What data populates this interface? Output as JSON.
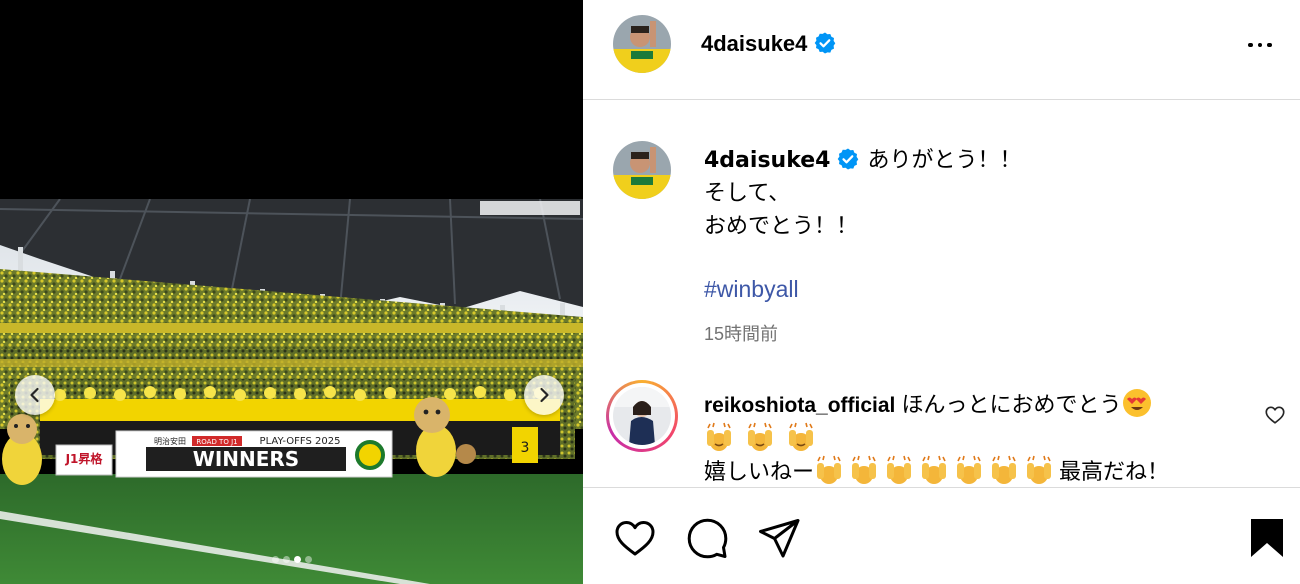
{
  "post": {
    "author": "4daisuke4",
    "verified": true,
    "caption_lines": [
      "ありがとう！！",
      "そして、",
      "おめでとう！！"
    ],
    "hashtag": "#winbyall",
    "time_ago": "15時間前"
  },
  "media": {
    "slide_count": 4,
    "active_slide": 3,
    "banner": {
      "title": "WINNERS",
      "subtitle": "PLAY-OFFS 2025",
      "sponsor": "明治安田",
      "tag": "ROAD TO J1",
      "side_sign": "J1昇格"
    }
  },
  "comment": {
    "author": "reikoshiota_official",
    "line1": "ほんっとにおめでとう",
    "line3_start": "嬉しいねー",
    "line3_end": "最高だね！"
  },
  "icons": {
    "verified": "verified-badge-icon",
    "more": "more-options-icon",
    "like": "heart-icon",
    "comment": "comment-icon",
    "share": "share-icon",
    "save": "bookmark-icon"
  },
  "colors": {
    "verified": "#0095f6",
    "hashtag": "#3d57a7",
    "muted": "#737373",
    "team_yellow": "#f2d400",
    "pitch_green": "#2f7a2e"
  }
}
